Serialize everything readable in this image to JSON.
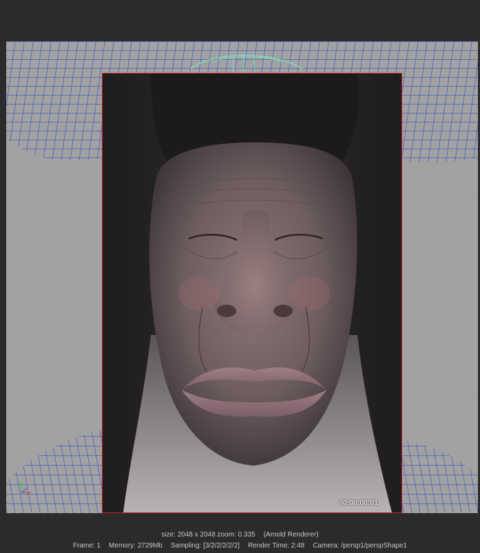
{
  "viewport": {
    "timecode": "00:00:00:01",
    "axis_gizmo": "xyz-axis-icon"
  },
  "status": {
    "size": "size: 2048 x 2048 zoom: 0.335",
    "renderer": "(Arnold Renderer)",
    "frame": "Frame: 1",
    "memory": "Memory: 2729Mb",
    "sampling": "Sampling: [3/2/2/2/2/2]",
    "render_time": "Render Time: 2:48",
    "camera": "Camera: /persp1/perspShape1"
  },
  "colors": {
    "background": "#2b2b2b",
    "viewport_bg": "#a2a2a2",
    "wireframe": "#1a3cc8",
    "wireframe_highlight": "#7fe0c0",
    "render_border": "#c8202a"
  }
}
